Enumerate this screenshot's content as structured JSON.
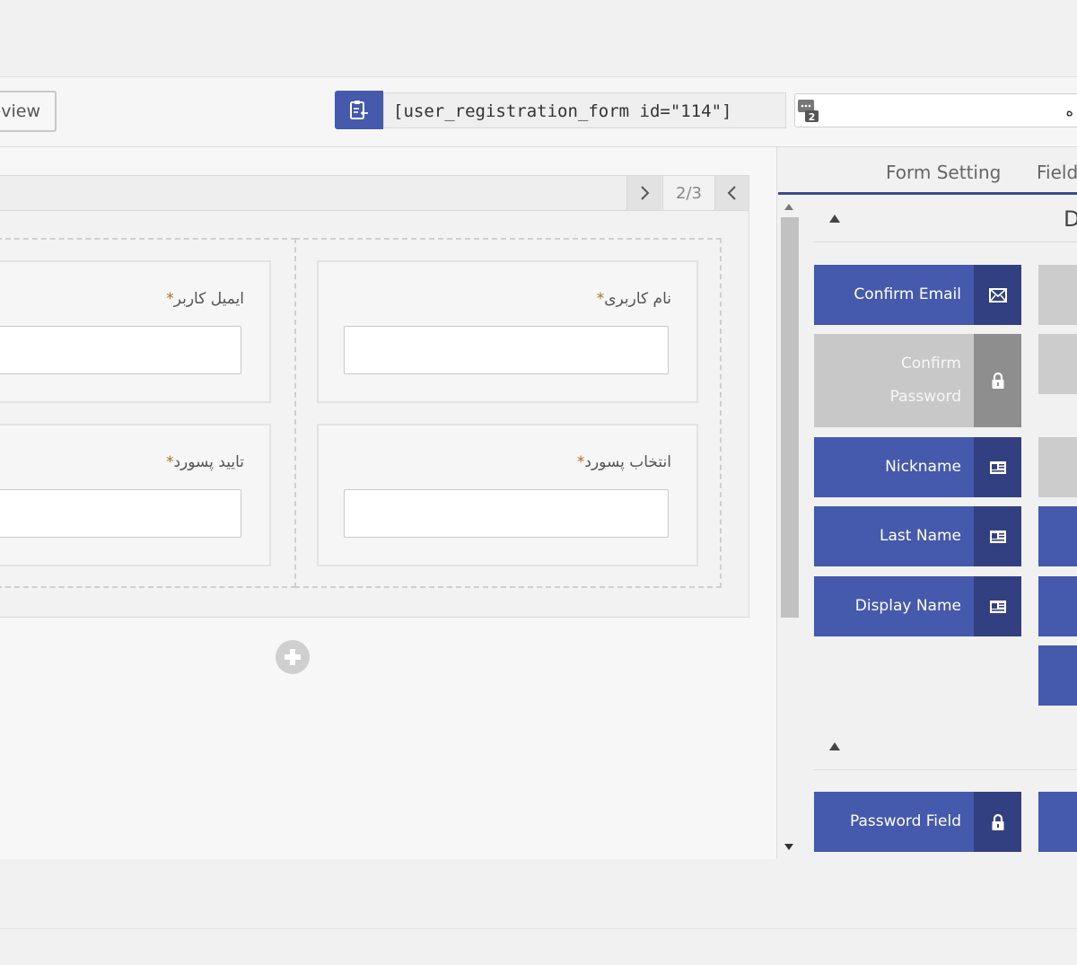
{
  "toolbar": {
    "preview_label": "Preview",
    "shortcode": "[user_registration_form id=\"114\"]",
    "form_title_value": "ه",
    "copy_icon": "clipboard-copy-icon",
    "language_icon": "language-switch-icon"
  },
  "builder": {
    "pager": {
      "count": "2/3"
    },
    "fields": [
      {
        "label": "ایمیل کاربر",
        "required_mark": "*"
      },
      {
        "label": "نام کاربری",
        "required_mark": "*"
      },
      {
        "label": "تایید پسورد",
        "required_mark": "*"
      },
      {
        "label": "انتخاب پسورد",
        "required_mark": "*"
      }
    ],
    "add_row_icon": "plus-circle-icon"
  },
  "panel": {
    "tabs": [
      {
        "label": "Form Setting"
      },
      {
        "label": "Field"
      }
    ],
    "section1_title": "D",
    "buttons": [
      {
        "label": "Confirm Email",
        "icon": "envelope-icon",
        "enabled": true
      },
      {
        "label": "Confirm\nPassword",
        "icon": "lock-icon",
        "enabled": false
      },
      {
        "label": "Nickname",
        "icon": "id-card-icon",
        "enabled": true
      },
      {
        "label": "Last Name",
        "icon": "id-card-icon",
        "enabled": true
      },
      {
        "label": "Display Name",
        "icon": "id-card-icon",
        "enabled": true
      },
      {
        "label": "Password Field",
        "icon": "lock-icon",
        "enabled": true
      }
    ]
  },
  "colors": {
    "accent": "#4559ad",
    "accent_dark": "#324082",
    "disabled": "#c8c8c8",
    "required": "#b36e1f"
  }
}
